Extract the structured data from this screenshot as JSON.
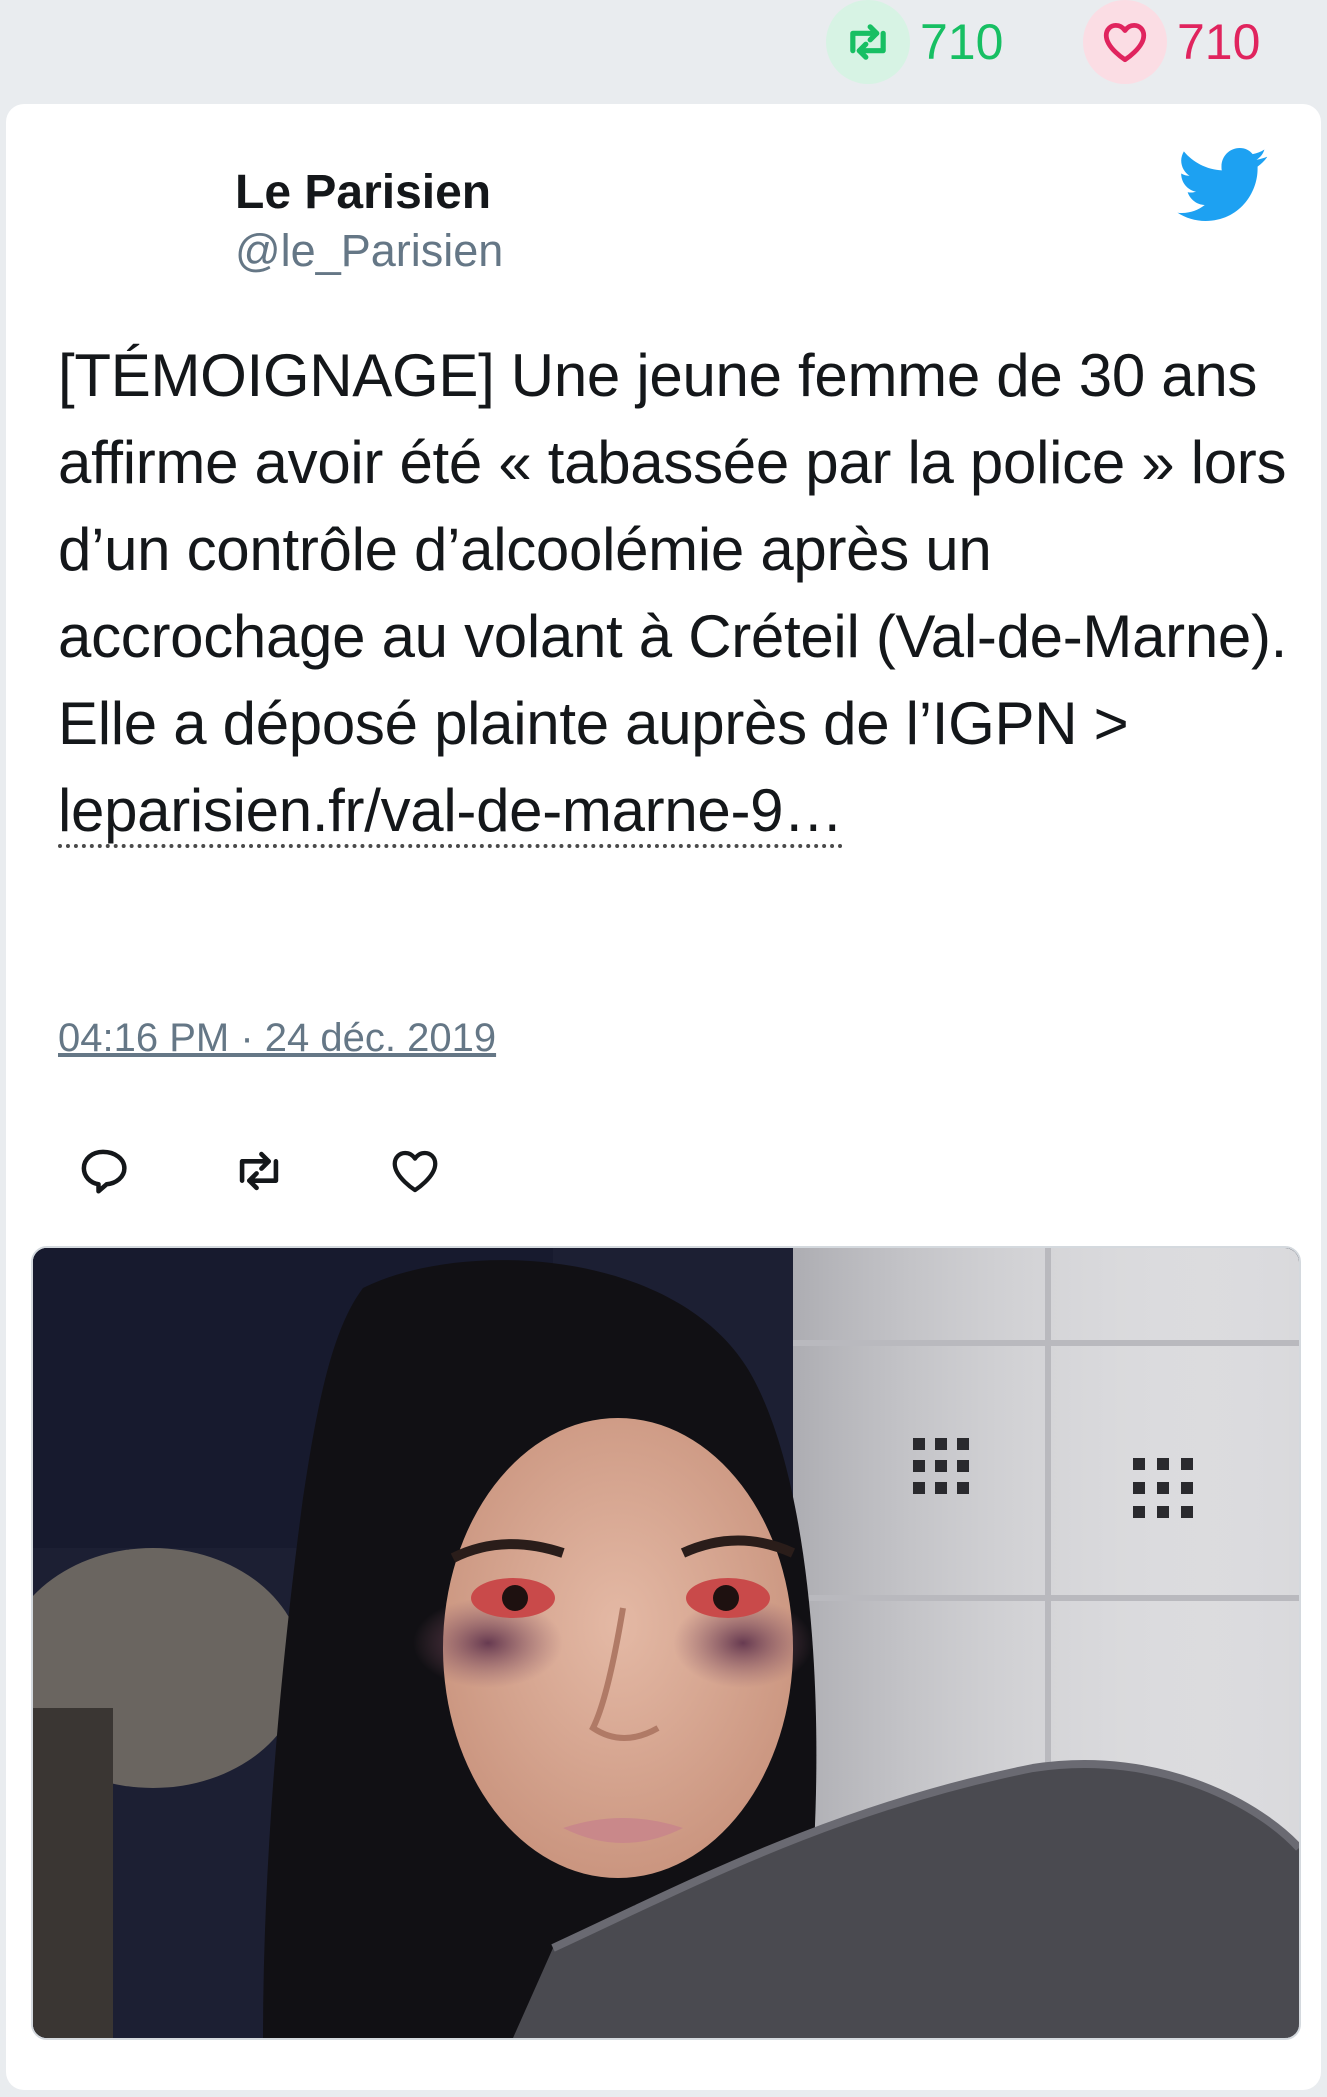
{
  "stats": {
    "retweets": "710",
    "likes": "710",
    "retweet_icon": "retweet-icon",
    "like_icon": "heart-icon",
    "retweet_color": "#17bf63",
    "like_color": "#e0245e"
  },
  "tweet": {
    "author_name": "Le Parisien",
    "author_handle": "@le_Parisien",
    "text": "[TÉMOIGNAGE] Une jeune femme de 30 ans affirme avoir été « tabassée par la police » lors d’un contrôle d’alcoolémie après un accrochage au volant à Créteil (Val-de-Marne). Elle a déposé plainte auprès de l’IGPN > ",
    "link_text": "leparisien.fr/val-de-marne-9…",
    "timestamp": "04:16 PM · 24 déc. 2019",
    "brand_icon": "twitter-bird-icon",
    "brand_color": "#1da1f2"
  },
  "actions": {
    "reply_icon": "reply-icon",
    "retweet_icon": "retweet-icon",
    "like_icon": "heart-icon"
  }
}
